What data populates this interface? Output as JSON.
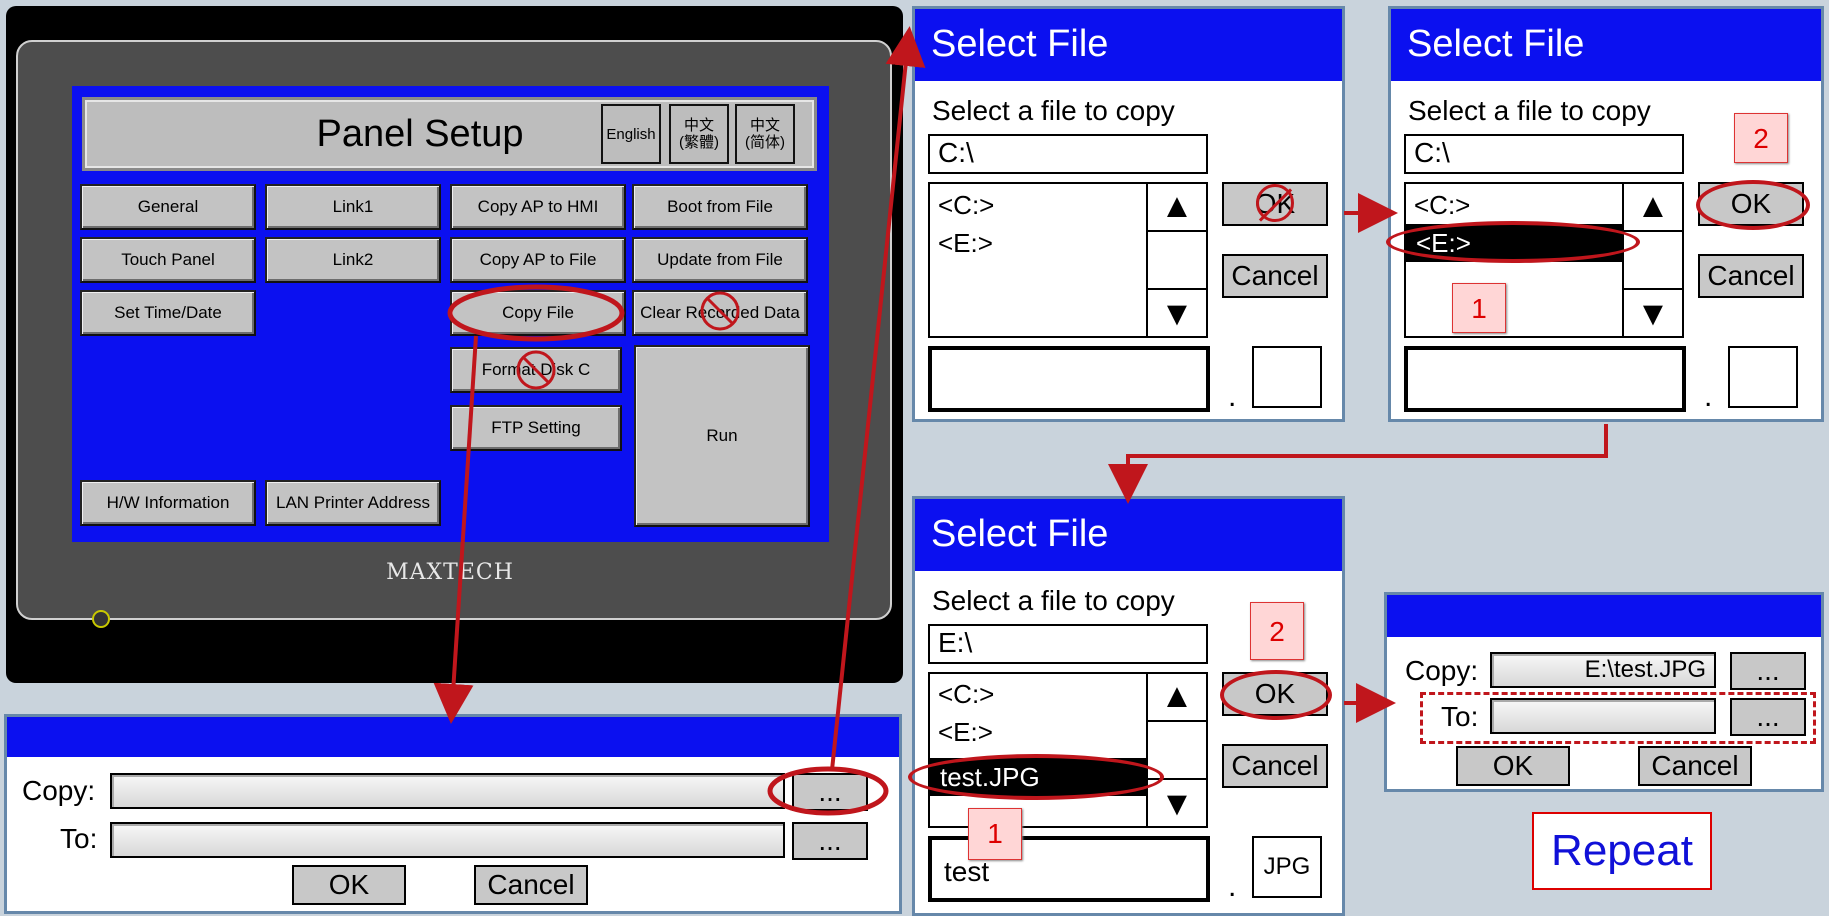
{
  "panel": {
    "title": "Panel Setup",
    "languages": [
      "English",
      "中文\n(繁體)",
      "中文\n(简体)"
    ],
    "buttons": {
      "general": "General",
      "link1": "Link1",
      "copy_ap_hmi": "Copy AP to HMI",
      "boot_from_file": "Boot from File",
      "touch_panel": "Touch Panel",
      "link2": "Link2",
      "copy_ap_file": "Copy AP to File",
      "update_from_file": "Update from File",
      "set_time": "Set Time/Date",
      "copy_file": "Copy File",
      "clear_recorded": "Clear Recorded Data",
      "format_disk": "Format Disk C",
      "ftp_setting": "FTP Setting",
      "run": "Run",
      "hw_info": "H/W Information",
      "lan_printer": "LAN Printer Address"
    },
    "logo": "MAXTECH"
  },
  "copy_dialog": {
    "copy_label": "Copy:",
    "to_label": "To:",
    "browse": "...",
    "ok": "OK",
    "cancel": "Cancel"
  },
  "select_file_1": {
    "title": "Select File",
    "prompt": "Select a file to copy",
    "path": "C:\\",
    "items": [
      "<C:>",
      "<E:>"
    ],
    "ok": "OK",
    "cancel": "Cancel",
    "dot": "."
  },
  "select_file_2": {
    "title": "Select File",
    "prompt": "Select a file to copy",
    "path": "C:\\",
    "items": [
      "<C:>",
      "<E:>"
    ],
    "ok": "OK",
    "cancel": "Cancel",
    "dot": ".",
    "step1": "1",
    "step2": "2"
  },
  "select_file_3": {
    "title": "Select File",
    "prompt": "Select a file to copy",
    "path": "E:\\",
    "items": [
      "<C:>",
      "<E:>",
      "test.JPG"
    ],
    "ok": "OK",
    "cancel": "Cancel",
    "dot": ".",
    "name": "test",
    "ext": "JPG",
    "step1": "1",
    "step2": "2"
  },
  "copy_dialog_2": {
    "copy_label": "Copy:",
    "copy_value": "E:\\test.JPG",
    "to_label": "To:",
    "browse": "...",
    "ok": "OK",
    "cancel": "Cancel"
  },
  "repeat_label": "Repeat",
  "colors": {
    "title_bar": "#0b10f0",
    "highlight": "#c0161c"
  }
}
